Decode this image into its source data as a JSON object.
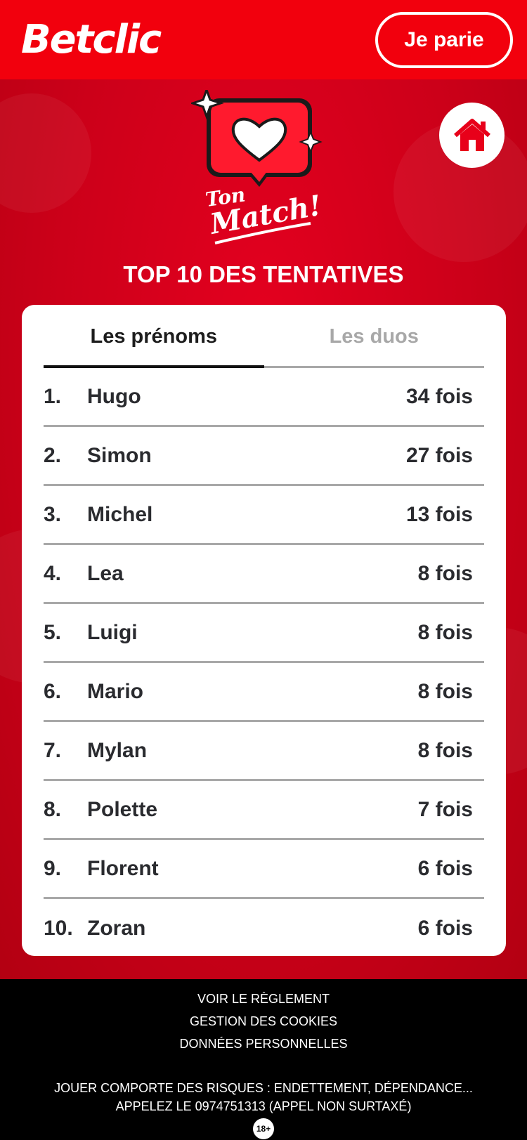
{
  "header": {
    "logo": "Betclic",
    "cta_label": "Je parie"
  },
  "hero": {
    "logo_line1": "Ton",
    "logo_line2": "Match!",
    "title": "TOP 10 DES TENTATIVES"
  },
  "tabs": [
    {
      "label": "Les prénoms",
      "active": true
    },
    {
      "label": "Les duos",
      "active": false
    }
  ],
  "ranking": [
    {
      "rank": "1.",
      "name": "Hugo",
      "count": "34 fois"
    },
    {
      "rank": "2.",
      "name": "Simon",
      "count": "27 fois"
    },
    {
      "rank": "3.",
      "name": "Michel",
      "count": "13 fois"
    },
    {
      "rank": "4.",
      "name": "Lea",
      "count": "8 fois"
    },
    {
      "rank": "5.",
      "name": "Luigi",
      "count": "8 fois"
    },
    {
      "rank": "6.",
      "name": "Mario",
      "count": "8 fois"
    },
    {
      "rank": "7.",
      "name": "Mylan",
      "count": "8 fois"
    },
    {
      "rank": "8.",
      "name": "Polette",
      "count": "7 fois"
    },
    {
      "rank": "9.",
      "name": "Florent",
      "count": "6 fois"
    },
    {
      "rank": "10.",
      "name": "Zoran",
      "count": "6 fois"
    }
  ],
  "footer": {
    "links": [
      "VOIR LE RÈGLEMENT",
      "GESTION DES COOKIES",
      "DONNÉES PERSONNELLES"
    ],
    "warning_line1": "JOUER COMPORTE DES RISQUES : ENDETTEMENT, DÉPENDANCE...",
    "warning_line2": "APPELEZ LE 0974751313 (APPEL NON SURTAXÉ)",
    "age_badge": "18+"
  },
  "colors": {
    "brand_red": "#f2000d",
    "hero_red": "#d6001c",
    "text_dark": "#2a2b2f",
    "muted": "#a8a8a8"
  },
  "icons": {
    "home": "home-icon",
    "heart": "heart-icon",
    "sparkle": "sparkle-icon"
  }
}
